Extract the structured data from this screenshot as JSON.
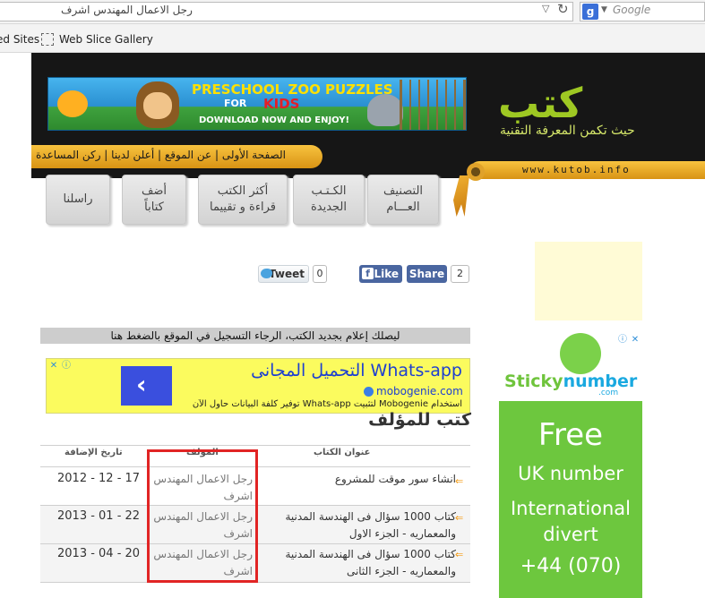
{
  "browser": {
    "url_text": "رجل الاعمال المهندس اشرف",
    "search_placeholder": "Google",
    "bookmarks": [
      "ed Sites",
      "Web Slice Gallery"
    ]
  },
  "banner": {
    "title": "PRESCHOOL ZOO PUZZLES",
    "for": "FOR",
    "kids": "KIDS",
    "cta": "DOWNLOAD NOW AND ENJOY!"
  },
  "site": {
    "logo": "كتب",
    "tagline": "حيث تكمن المعرفة التقنية",
    "url": "www.kutob.info",
    "top_links": "الصفحة الأولى | عن الموقع | أعلن لدينا | ركن المساعدة"
  },
  "nav_tabs": [
    {
      "label": "التصنيف\nالعـــام"
    },
    {
      "label": "الكـتـب\nالجديدة"
    },
    {
      "label": "أكثر الكتب\nقراءة و تقييما"
    },
    {
      "label": "أضف\nكتاباً"
    },
    {
      "label": "راسلنا"
    }
  ],
  "social": {
    "tweet_label": "Tweet",
    "tweet_count": "0",
    "like_label": "Like",
    "share_label": "Share",
    "share_count": "2"
  },
  "notice": "ليصلك إعلام بجديد الكتب، الرجاء التسجيل في الموقع بالضغط هنا",
  "whatsapp_ad": {
    "title": "Whats-app التحميل المجانى",
    "site": "mobogenie.com",
    "body": "استخدام Mobogenie لتثبيت Whats-app توفير كلفة البيانات حاول الآن"
  },
  "heading": "كتب للمؤلف",
  "table": {
    "columns": [
      "عنوان الكتاب",
      "المؤلف",
      "تاريخ الإضافة"
    ],
    "rows": [
      {
        "title": "انشاء سور موقت للمشروع",
        "author": "رجل الاعمال المهندس اشرف",
        "date": "2012 - 12 - 17"
      },
      {
        "title": "كتاب 1000 سؤال فى الهندسة المدنية والمعماريه - الجزء الاول",
        "author": "رجل الاعمال المهندس اشرف",
        "date": "2013 - 01 - 22"
      },
      {
        "title": "كتاب 1000 سؤال فى الهندسة المدنية والمعماريه - الجزء الثانى",
        "author": "رجل الاعمال المهندس اشرف",
        "date": "2013 - 04 - 20"
      }
    ]
  },
  "sticky_ad": {
    "logo_a": "Sticky",
    "logo_b": "number",
    "logo_com": ".com",
    "line1": "Free",
    "line2": "UK number",
    "line3": "International",
    "line4": "divert",
    "line5": "+44 (070)"
  },
  "colors": {
    "highlight_box": "#e12424",
    "header_bg": "#161616",
    "accent_gold": "#f8c33f",
    "ad_green": "#6dc73e"
  }
}
